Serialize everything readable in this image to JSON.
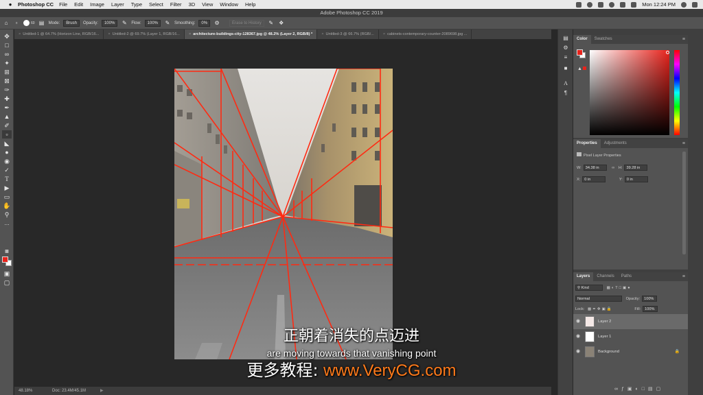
{
  "menubar": {
    "app_name": "Photoshop CC",
    "items": [
      "File",
      "Edit",
      "Image",
      "Layer",
      "Type",
      "Select",
      "Filter",
      "3D",
      "View",
      "Window",
      "Help"
    ],
    "clock": "Mon 12:24 PM"
  },
  "window": {
    "title": "Adobe Photoshop CC 2019"
  },
  "options": {
    "brush_size": "60",
    "mode_label": "Mode:",
    "mode_value": "Brush",
    "opacity_label": "Opacity:",
    "opacity_value": "100%",
    "flow_label": "Flow:",
    "flow_value": "100%",
    "smoothing_label": "Smoothing:",
    "smoothing_value": "0%",
    "erase_to_history": "Erase to History"
  },
  "tabs": [
    "Untitled-1 @ 64.7% (Horizon Line, RGB/16...",
    "Untitled-2 @ 69.7% (Layer 1, RGB/16...",
    "architecture-buildings-city-128367.jpg @ 48.2% (Layer 2, RGB/8) *",
    "Untitled-3 @ 66.7% (RGB/...",
    "cabinets-contemporary-counter-2089698.jpg ..."
  ],
  "status": {
    "zoom": "48.18%",
    "doc": "Doc: 23.4M/45.1M"
  },
  "color_panel": {
    "tabs": [
      "Color",
      "Swatches"
    ],
    "foreground": "#e8231c",
    "background": "#ffffff",
    "hue_field": "#e8231c"
  },
  "properties_panel": {
    "tabs": [
      "Properties",
      "Adjustments"
    ],
    "heading": "Pixel Layer Properties",
    "w_label": "W:",
    "w_value": "34.38 in",
    "h_label": "H:",
    "h_value": "39.28 in",
    "x_label": "X:",
    "x_value": "0 in",
    "y_label": "Y:",
    "y_value": "0 in"
  },
  "layers_panel": {
    "tabs": [
      "Layers",
      "Channels",
      "Paths"
    ],
    "kind_label": "Kind",
    "blend_mode": "Normal",
    "opacity_label": "Opacity:",
    "opacity_value": "100%",
    "lock_label": "Lock:",
    "fill_label": "Fill:",
    "fill_value": "100%",
    "layers": [
      {
        "name": "Layer 2",
        "selected": true
      },
      {
        "name": "Layer 1",
        "selected": false
      },
      {
        "name": "Background",
        "selected": false,
        "locked": true
      }
    ]
  },
  "subtitles": {
    "chinese": "正朝着消失的点迈进",
    "english": "are moving towards that vanishing point",
    "promo_prefix": "更多教程: ",
    "promo_url": "www.VeryCG.com"
  },
  "accent_colors": {
    "perspective_lines": "#ff2a12",
    "promo_url": "#ff7a1a"
  }
}
